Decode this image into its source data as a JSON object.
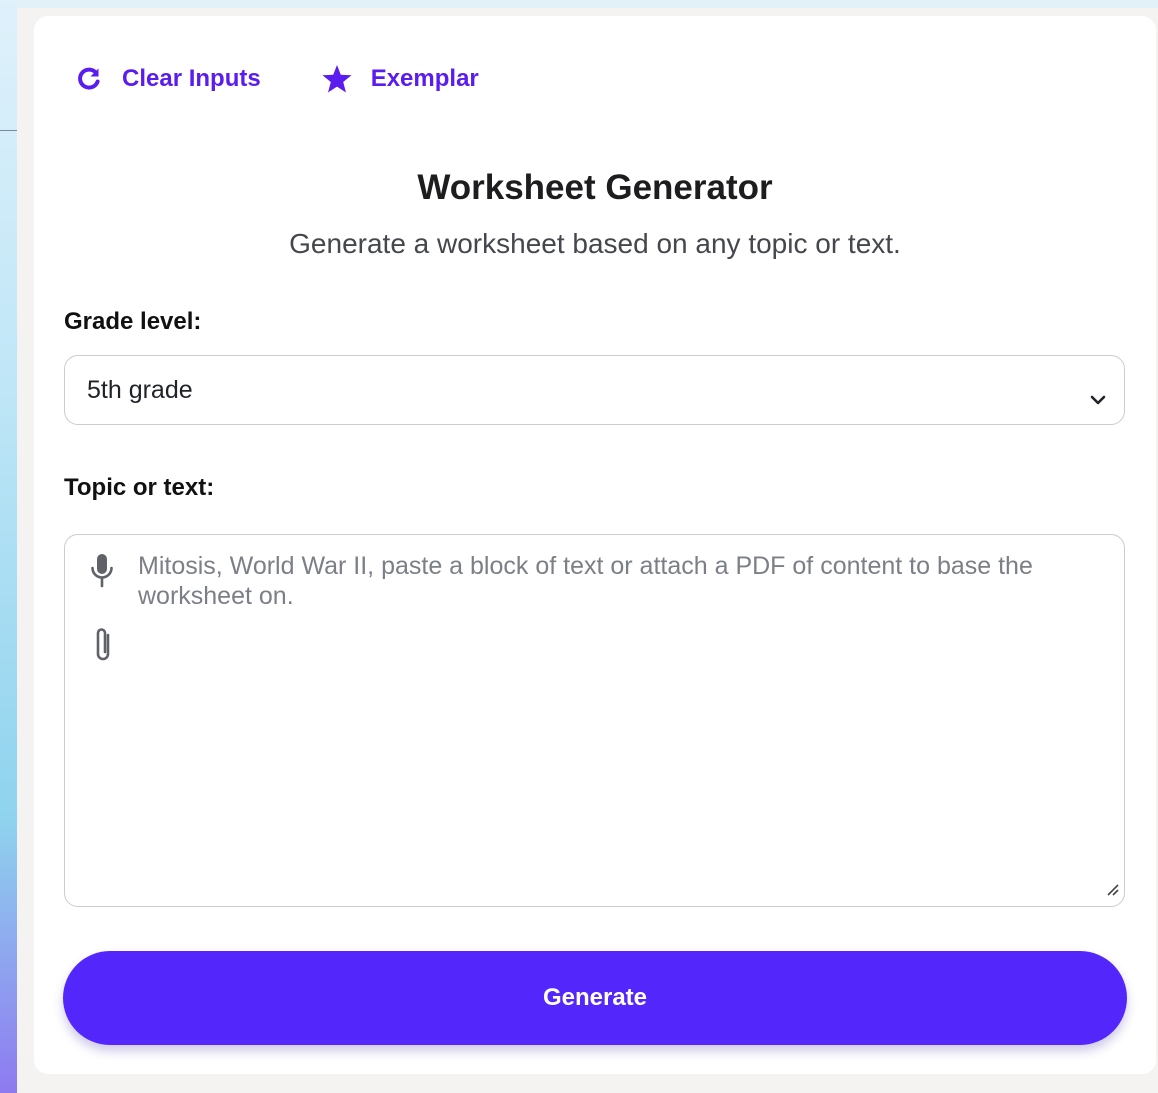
{
  "toolbar": {
    "clear_label": "Clear Inputs",
    "exemplar_label": "Exemplar"
  },
  "header": {
    "title": "Worksheet Generator",
    "subtitle": "Generate a worksheet based on any topic or text."
  },
  "form": {
    "grade_label": "Grade level:",
    "grade_value": "5th grade",
    "topic_label": "Topic or text:",
    "topic_placeholder": "Mitosis, World War II, paste a block of text or attach a PDF of content to base the worksheet on.",
    "topic_value": ""
  },
  "actions": {
    "generate_label": "Generate"
  },
  "colors": {
    "accent": "#5b1cf0",
    "button": "#5327fb",
    "card": "#ffffff",
    "page": "#f4f3f1"
  },
  "icons": {
    "clear": "refresh-icon",
    "exemplar": "star-icon",
    "select": "chevron-down-icon",
    "voice": "microphone-icon",
    "attach": "paperclip-icon",
    "resize": "resize-handle-icon"
  }
}
